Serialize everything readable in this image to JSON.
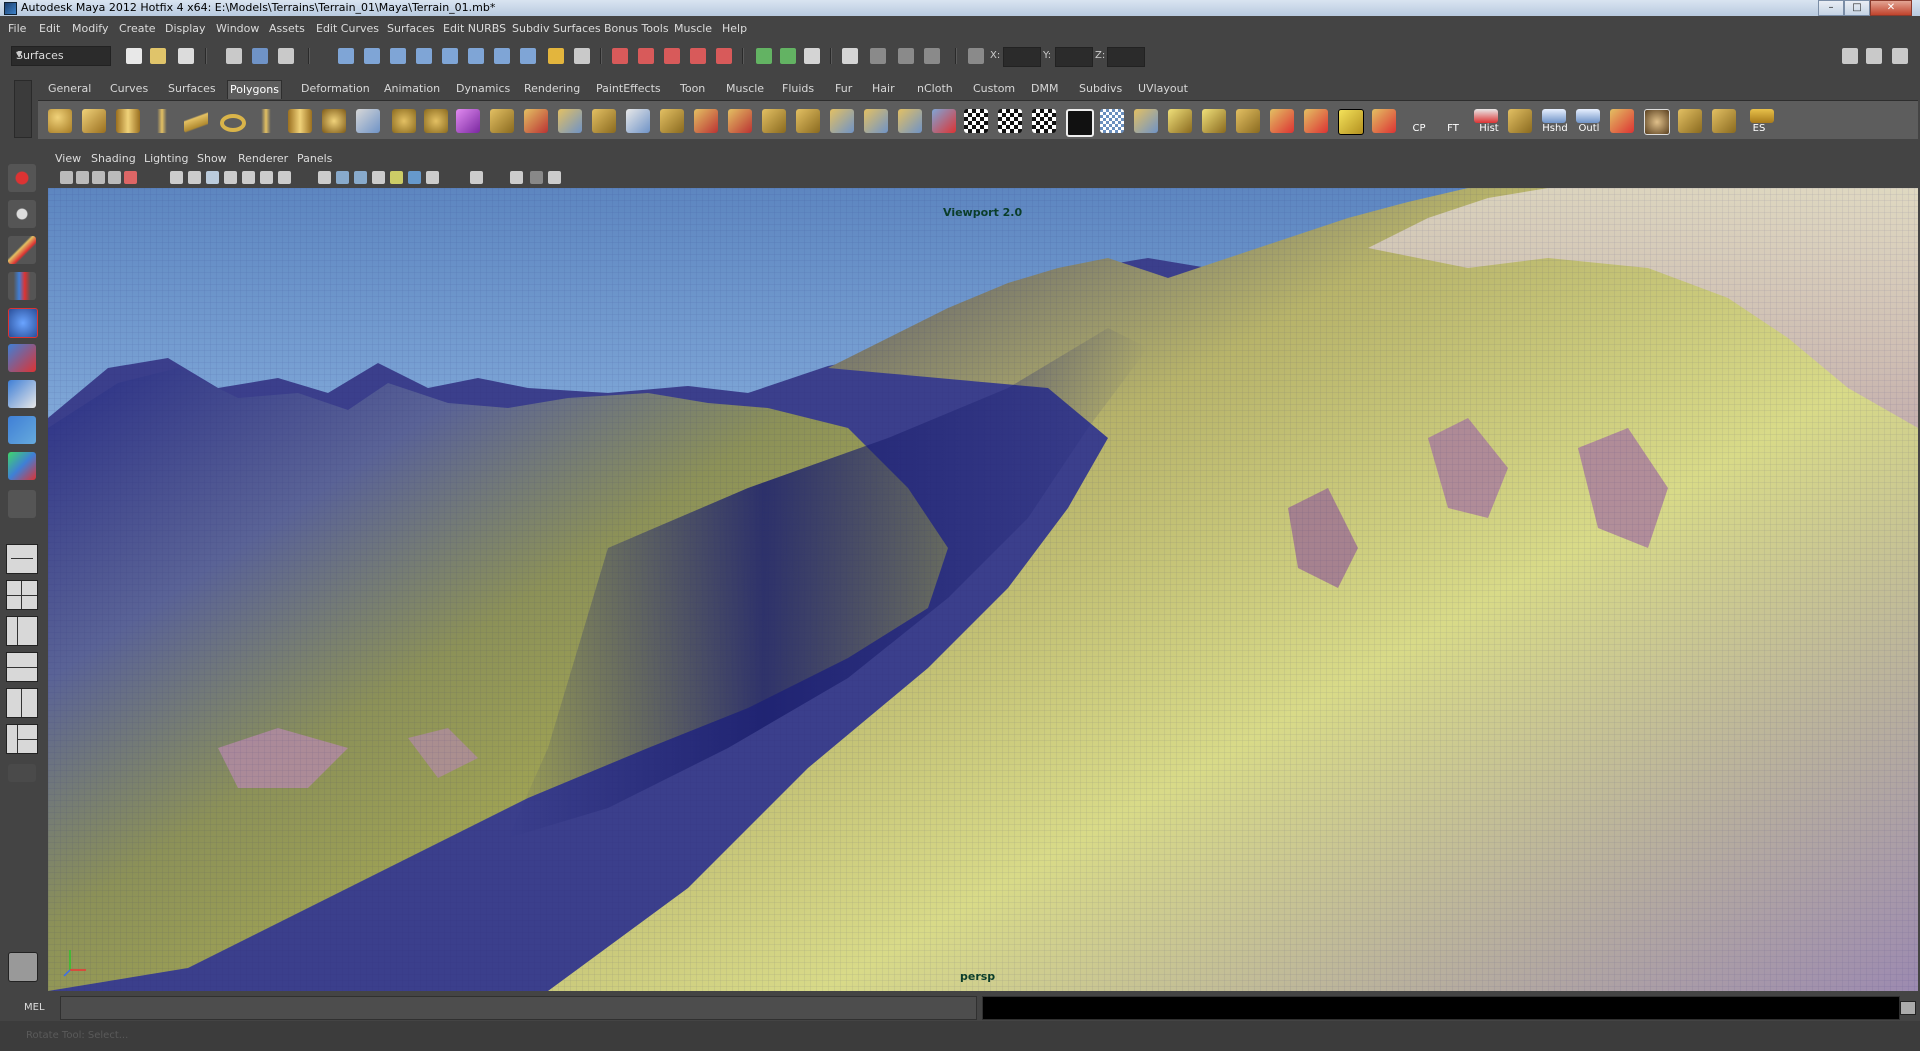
{
  "window": {
    "title": "Autodesk Maya 2012 Hotfix 4 x64: E:\\Models\\Terrains\\Terrain_01\\Maya\\Terrain_01.mb*",
    "minimize": "–",
    "maximize": "□",
    "close": "✕"
  },
  "menu": [
    "File",
    "Edit",
    "Modify",
    "Create",
    "Display",
    "Window",
    "Assets",
    "Edit Curves",
    "Surfaces",
    "Edit NURBS",
    "Subdiv Surfaces",
    "Bonus Tools",
    "Muscle",
    "Help"
  ],
  "statusline": {
    "menuset": "Surfaces",
    "x_label": "X:",
    "y_label": "Y:",
    "z_label": "Z:"
  },
  "shelf_tabs": [
    "General",
    "Curves",
    "Surfaces",
    "Polygons",
    "Deformation",
    "Animation",
    "Dynamics",
    "Rendering",
    "PaintEffects",
    "Toon",
    "Muscle",
    "Fluids",
    "Fur",
    "Hair",
    "nCloth",
    "Custom",
    "DMM",
    "Subdivs",
    "UVlayout"
  ],
  "active_shelf_tab": "Polygons",
  "shelf_labels": {
    "cp": "CP",
    "ft": "FT",
    "hist": "Hist",
    "hshd": "Hshd",
    "outl": "Outl",
    "es": "ES"
  },
  "panel_menu": [
    "View",
    "Shading",
    "Lighting",
    "Show",
    "Renderer",
    "Panels"
  ],
  "viewport": {
    "renderer": "Viewport 2.0",
    "camera": "persp"
  },
  "command_line": {
    "label": "MEL"
  },
  "help_line": {
    "text": "Rotate Tool: Select..."
  },
  "colors": {
    "ui_bg": "#444444",
    "sky": "#8cb3e0",
    "terrain_grass": "#a8ab52",
    "terrain_shadow": "#1b1f6e",
    "terrain_rock": "#a77a9e"
  }
}
